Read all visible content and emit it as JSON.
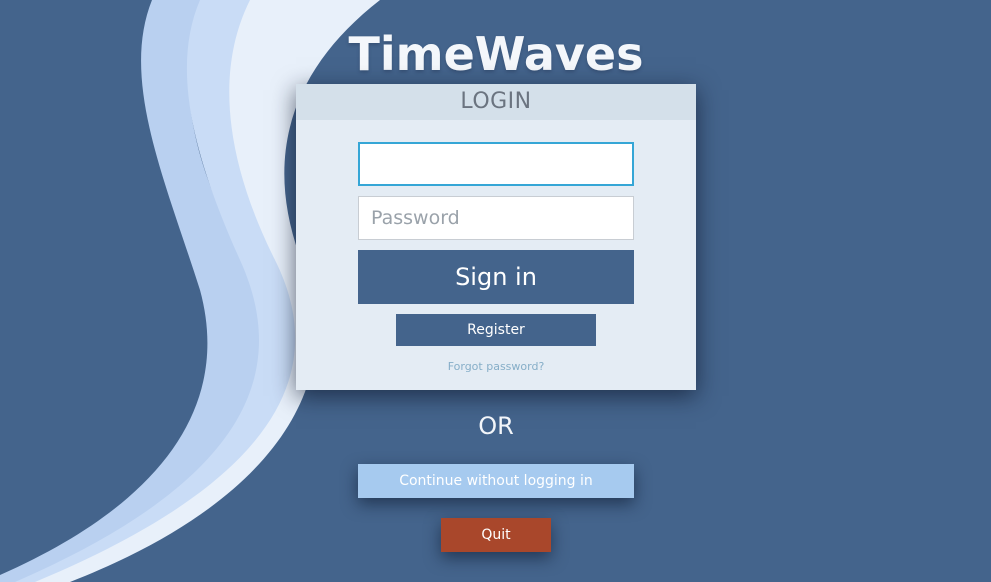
{
  "app": {
    "logo_text": "TimeWaves"
  },
  "login_panel": {
    "header": "LOGIN",
    "username": {
      "value": "",
      "placeholder": ""
    },
    "password": {
      "value": "",
      "placeholder": "Password"
    },
    "sign_in_label": "Sign in",
    "register_label": "Register",
    "forgot_password_label": "Forgot password?"
  },
  "or_label": "OR",
  "continue_label": "Continue without logging in",
  "quit_label": "Quit",
  "colors": {
    "background": "#44648c",
    "primary_button": "#44648c",
    "secondary_button": "#a6caef",
    "quit_button": "#a9472b",
    "focus_border": "#35a6d6",
    "wave_light": "#e8f0fa",
    "wave_mid": "#c3d6f4",
    "wave_dark": "#9fbde8"
  }
}
